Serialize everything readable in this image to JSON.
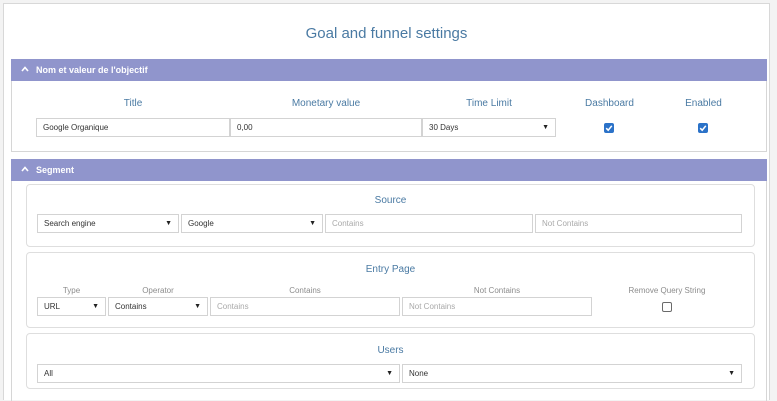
{
  "page": {
    "title": "Goal and funnel settings"
  },
  "goal_panel": {
    "header": "Nom et valeur de l'objectif",
    "columns": {
      "title": "Title",
      "monetary": "Monetary value",
      "time_limit": "Time Limit",
      "dashboard": "Dashboard",
      "enabled": "Enabled"
    },
    "title_value": "Google Organique",
    "monetary_value": "0,00",
    "time_limit_value": "30 Days",
    "dashboard_checked": true,
    "enabled_checked": true
  },
  "segment_panel": {
    "header": "Segment",
    "source": {
      "title": "Source",
      "type_value": "Search engine",
      "engine_value": "Google",
      "contains_placeholder": "Contains",
      "not_contains_placeholder": "Not Contains"
    },
    "entry_page": {
      "title": "Entry Page",
      "labels": {
        "type": "Type",
        "operator": "Operator",
        "contains": "Contains",
        "not_contains": "Not Contains",
        "remove_query": "Remove Query String"
      },
      "type_value": "URL",
      "operator_value": "Contains",
      "contains_placeholder": "Contains",
      "not_contains_placeholder": "Not Contains",
      "remove_query_checked": false
    },
    "users": {
      "title": "Users",
      "left_value": "All",
      "right_value": "None"
    }
  },
  "icons": {
    "caret": "caret-down-icon",
    "chevron": "chevron-up-icon",
    "check": "check-icon"
  },
  "colors": {
    "header_bg": "#9095cc",
    "accent_text": "#4a7aa3",
    "checkbox": "#2b72c8"
  }
}
